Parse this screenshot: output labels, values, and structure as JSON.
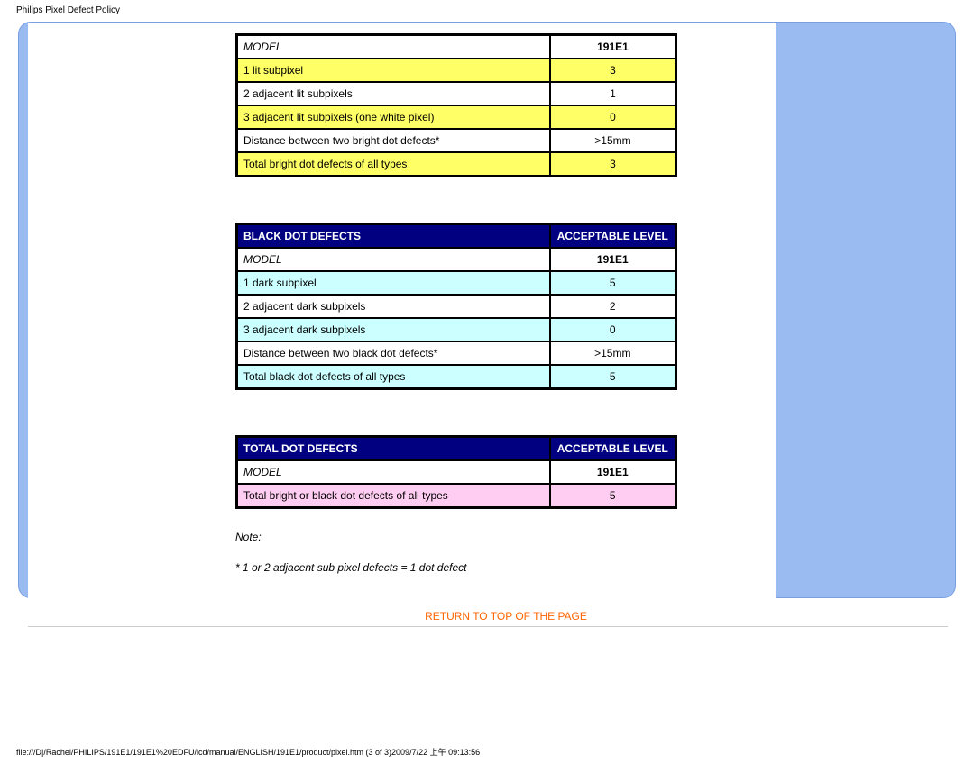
{
  "page_title": "Philips Pixel Defect Policy",
  "footer_path": "file:///D|/Rachel/PHILIPS/191E1/191E1%20EDFU/lcd/manual/ENGLISH/191E1/product/pixel.htm (3 of 3)2009/7/22 上午 09:13:56",
  "table1": {
    "model_label": "MODEL",
    "model_value": "191E1",
    "rows": [
      {
        "label": "1 lit subpixel",
        "value": "3",
        "hl": true
      },
      {
        "label": "2 adjacent lit subpixels",
        "value": "1",
        "hl": false
      },
      {
        "label": "3 adjacent lit subpixels (one white pixel)",
        "value": "0",
        "hl": true
      },
      {
        "label": "Distance between two bright dot defects*",
        "value": ">15mm",
        "hl": false
      },
      {
        "label": "Total bright dot defects of all types",
        "value": "3",
        "hl": true
      }
    ]
  },
  "table2": {
    "header_left": "BLACK DOT DEFECTS",
    "header_right": "ACCEPTABLE LEVEL",
    "model_label": "MODEL",
    "model_value": "191E1",
    "rows": [
      {
        "label": "1 dark subpixel",
        "value": "5",
        "hl": true
      },
      {
        "label": "2 adjacent dark subpixels",
        "value": "2",
        "hl": false
      },
      {
        "label": "3 adjacent dark subpixels",
        "value": "0",
        "hl": true
      },
      {
        "label": "Distance between two black dot defects*",
        "value": ">15mm",
        "hl": false
      },
      {
        "label": "Total black dot defects of all types",
        "value": "5",
        "hl": true
      }
    ]
  },
  "table3": {
    "header_left": "TOTAL DOT DEFECTS",
    "header_right": "ACCEPTABLE LEVEL",
    "model_label": "MODEL",
    "model_value": "191E1",
    "rows": [
      {
        "label": "Total bright or black dot defects of all types",
        "value": "5",
        "hl": true
      }
    ]
  },
  "note": {
    "line1": "Note:",
    "line2": "* 1 or 2 adjacent sub pixel defects = 1 dot defect"
  },
  "return_link": "RETURN TO TOP OF THE PAGE"
}
